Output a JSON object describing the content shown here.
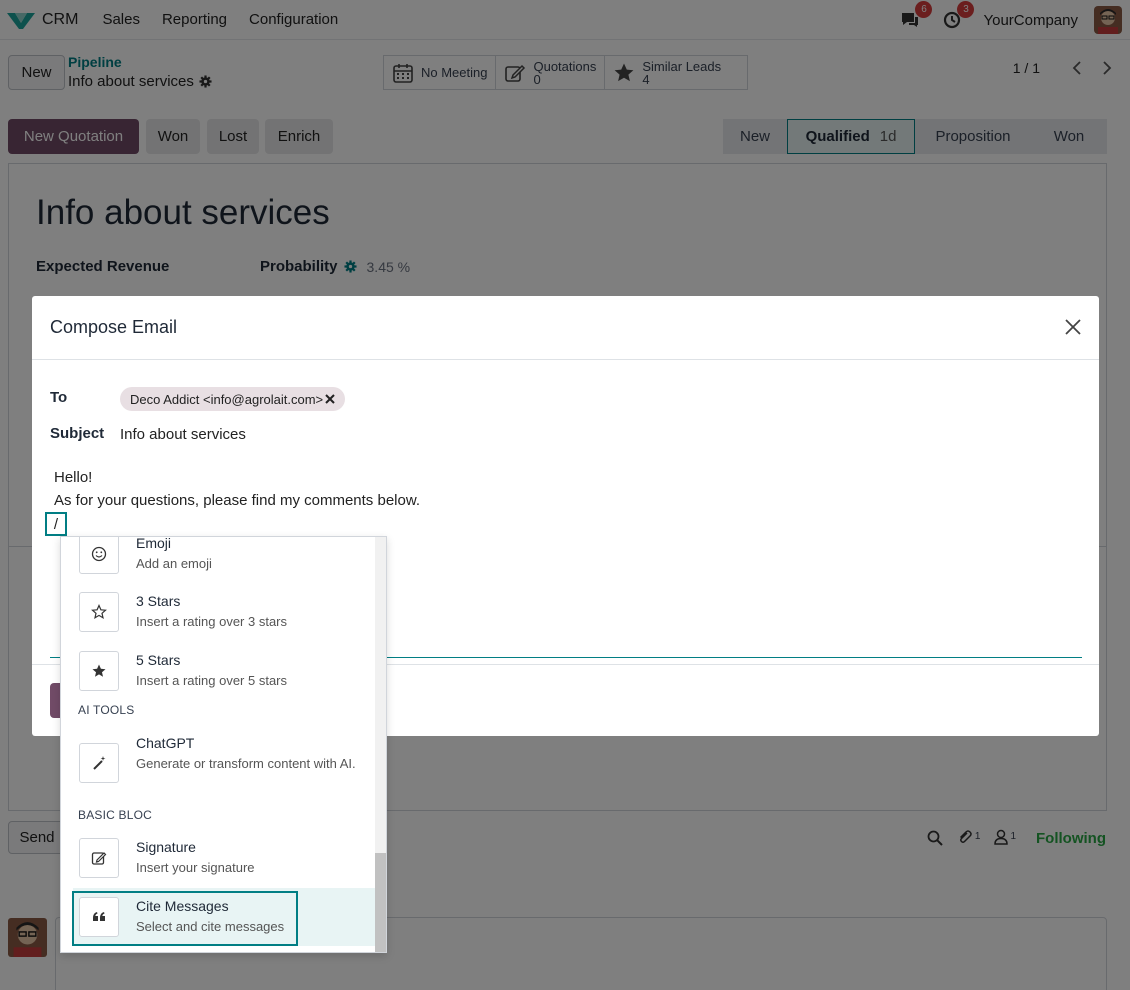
{
  "navbar": {
    "app_name": "CRM",
    "menus": [
      "Sales",
      "Reporting",
      "Configuration"
    ],
    "messages_count": "6",
    "activities_count": "3",
    "company": "YourCompany"
  },
  "control_panel": {
    "new_label": "New",
    "breadcrumb": "Pipeline",
    "record_title": "Info about services",
    "smart_buttons": {
      "meeting": "No Meeting",
      "quotations_label": "Quotations",
      "quotations_count": "0",
      "similar_label": "Similar Leads",
      "similar_count": "4"
    },
    "pager": "1 / 1"
  },
  "actions": {
    "new_quotation": "New Quotation",
    "won": "Won",
    "lost": "Lost",
    "enrich": "Enrich"
  },
  "stages": {
    "new": "New",
    "qualified": "Qualified",
    "qualified_duration": "1d",
    "proposition": "Proposition",
    "won": "Won"
  },
  "sheet": {
    "title": "Info about services",
    "expected_revenue_label": "Expected Revenue",
    "probability_label": "Probability",
    "probability_auto": "3.45 %"
  },
  "chatter": {
    "send_label": "Send",
    "attachments_count": "1",
    "followers_count": "1",
    "following_label": "Following"
  },
  "modal": {
    "title": "Compose Email",
    "to_label": "To",
    "recipient": "Deco Addict <info@agrolait.com>",
    "subject_label": "Subject",
    "subject_value": "Info about services",
    "body_line_1": "Hello!",
    "body_line_2": "As for your questions, please find my comments below.",
    "body_slash": "/"
  },
  "powerbox": {
    "items": [
      {
        "name": "Emoji",
        "desc": "Add an emoji",
        "icon": "smile-icon"
      },
      {
        "name": "3 Stars",
        "desc": "Insert a rating over 3 stars",
        "icon": "star-outline-icon"
      },
      {
        "name": "5 Stars",
        "desc": "Insert a rating over 5 stars",
        "icon": "star-filled-icon"
      },
      {
        "name": "ChatGPT",
        "desc": "Generate or transform content with AI.",
        "icon": "magic-wand-icon"
      },
      {
        "name": "Signature",
        "desc": "Insert your signature",
        "icon": "signature-icon"
      },
      {
        "name": "Cite Messages",
        "desc": "Select and cite messages",
        "icon": "quote-icon"
      }
    ],
    "categories": [
      "AI TOOLS",
      "BASIC BLOC"
    ]
  },
  "colors": {
    "primary": "#714b67",
    "accent": "#017e84",
    "badge": "#d63c3c",
    "following": "#28a745"
  }
}
